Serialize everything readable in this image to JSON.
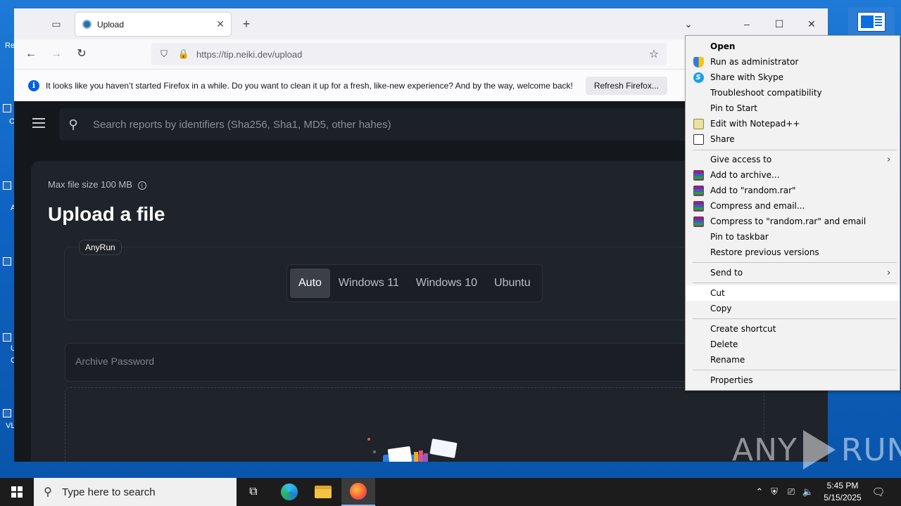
{
  "browser": {
    "tab_title": "Upload",
    "url_host": "https://tip.neiki.dev",
    "url_path": "/upload",
    "notice_text": "It looks like you haven’t started Firefox in a while. Do you want to clean it up for a fresh, like-new experience? And by the way, welcome back!",
    "notice_button": "Refresh Firefox..."
  },
  "page": {
    "search_placeholder": "Search reports by identifiers (Sha256, Sha1, MD5, other hahes)",
    "max_size": "Max file size 100 MB",
    "title": "Upload a file",
    "provider_chip": "AnyRun",
    "os_options": [
      "Auto",
      "Windows 11",
      "Windows 10",
      "Ubuntu"
    ],
    "os_selected": "Auto",
    "password_placeholder": "Archive Password"
  },
  "context_menu": {
    "items": [
      {
        "label": "Open",
        "bold": true
      },
      {
        "label": "Run as administrator",
        "icon": "shield-icon"
      },
      {
        "label": "Share with Skype",
        "icon": "skype-icon"
      },
      {
        "label": "Troubleshoot compatibility"
      },
      {
        "label": "Pin to Start"
      },
      {
        "label": "Edit with Notepad++",
        "icon": "notepadpp-icon"
      },
      {
        "label": "Share",
        "icon": "share-icon"
      },
      {
        "label": "Give access to",
        "submenu": true
      },
      {
        "label": "Add to archive...",
        "icon": "winrar-icon"
      },
      {
        "label": "Add to \"random.rar\"",
        "icon": "winrar-icon"
      },
      {
        "label": "Compress and email...",
        "icon": "winrar-icon"
      },
      {
        "label": "Compress to \"random.rar\" and email",
        "icon": "winrar-icon"
      },
      {
        "label": "Pin to taskbar"
      },
      {
        "label": "Restore previous versions"
      },
      {
        "label": "Send to",
        "submenu": true
      },
      {
        "label": "Cut",
        "highlighted": true
      },
      {
        "label": "Copy"
      },
      {
        "label": "Create shortcut"
      },
      {
        "label": "Delete"
      },
      {
        "label": "Rename"
      },
      {
        "label": "Properties"
      }
    ]
  },
  "taskbar": {
    "search_placeholder": "Type here to search",
    "time": "5:45 PM",
    "date": "5/15/2025"
  },
  "desktop": {
    "fragments": [
      "Re",
      "C",
      "A",
      "U",
      "C",
      "VL"
    ]
  },
  "watermark": {
    "left": "ANY",
    "right": "RUN"
  }
}
